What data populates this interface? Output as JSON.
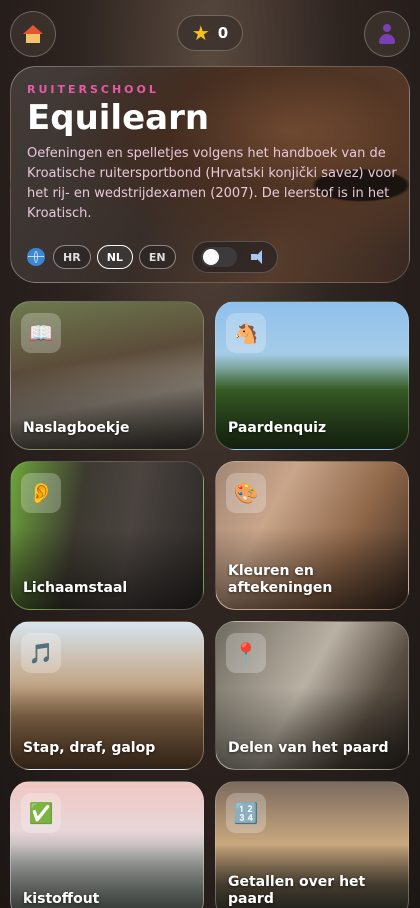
{
  "topbar": {
    "home_icon": "house-icon",
    "score_icon": "star-icon",
    "score": "0",
    "profile_icon": "person-silhouette-icon"
  },
  "hero": {
    "kicker": "RUITERSCHOOL",
    "title": "Equilearn",
    "description": "Oefeningen en spelletjes volgens het handboek van de Kroatische ruitersportbond (Hrvatski konjički savez) voor het rij- en wedstrijdexamen (2007). De leerstof is in het Kroatisch.",
    "languages": [
      {
        "code": "HR",
        "active": false
      },
      {
        "code": "NL",
        "active": true
      },
      {
        "code": "EN",
        "active": false
      }
    ],
    "sound_toggle_on": false,
    "colors": {
      "kicker": "#e85aa6",
      "description": "#e7c7d9"
    }
  },
  "cards": [
    {
      "label": "Naslagboekje",
      "icon": "book-icon",
      "glyph": "📖"
    },
    {
      "label": "Paardenquiz",
      "icon": "horse-face-icon",
      "glyph": "🐴"
    },
    {
      "label": "Lichaamstaal",
      "icon": "ear-icon",
      "glyph": "👂"
    },
    {
      "label": "Kleuren en aftekeningen",
      "icon": "palette-icon",
      "glyph": "🎨"
    },
    {
      "label": "Stap, draf, galop",
      "icon": "music-note-icon",
      "glyph": "🎵"
    },
    {
      "label": "Delen van het paard",
      "icon": "pin-icon",
      "glyph": "📍"
    },
    {
      "label": "kistoffout",
      "icon": "checkbox-icon",
      "glyph": "✅"
    },
    {
      "label": "Getallen over het paard",
      "icon": "numbers-icon",
      "glyph": "🔢"
    }
  ]
}
